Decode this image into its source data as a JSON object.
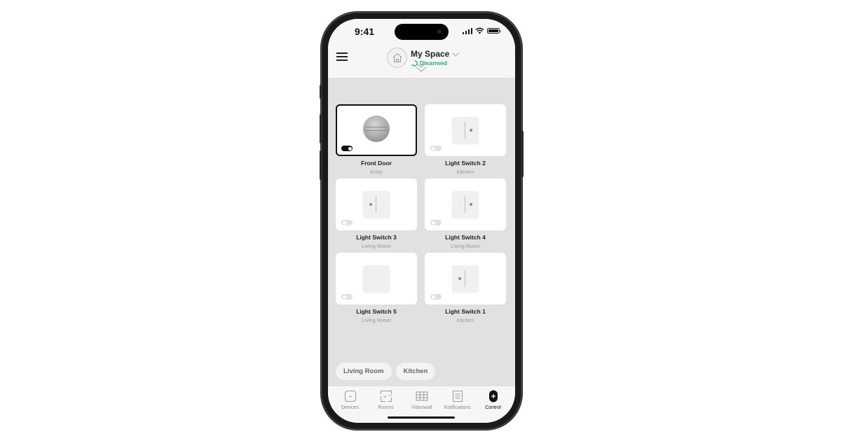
{
  "status_bar": {
    "time": "9:41"
  },
  "header": {
    "space_name": "My Space",
    "security_status": "Disarmed",
    "status_color": "#1fb27a"
  },
  "devices": [
    {
      "name": "Front Door",
      "room": "Entry",
      "type": "lock",
      "toggle_on": true,
      "selected": true
    },
    {
      "name": "Light Switch 2",
      "room": "Kitchen",
      "type": "switch-dot-right",
      "toggle_on": false,
      "selected": false
    },
    {
      "name": "Light Switch 3",
      "room": "Living Room",
      "type": "switch-dot-left",
      "toggle_on": false,
      "selected": false
    },
    {
      "name": "Light Switch 4",
      "room": "Living Room",
      "type": "switch-dot-right",
      "toggle_on": false,
      "selected": false
    },
    {
      "name": "Light Switch 5",
      "room": "Living Room",
      "type": "switch-blank",
      "toggle_on": false,
      "selected": false
    },
    {
      "name": "Light Switch 1",
      "room": "Kitchen",
      "type": "switch-dot-left",
      "toggle_on": false,
      "selected": false
    }
  ],
  "room_filters": [
    "Living Room",
    "Kitchen"
  ],
  "tabs": [
    {
      "label": "Devices",
      "icon": "devices-icon"
    },
    {
      "label": "Rooms",
      "icon": "rooms-icon"
    },
    {
      "label": "Videowall",
      "icon": "videowall-icon"
    },
    {
      "label": "Notifications",
      "icon": "notifications-icon"
    },
    {
      "label": "Control",
      "icon": "control-icon",
      "active": true
    }
  ]
}
